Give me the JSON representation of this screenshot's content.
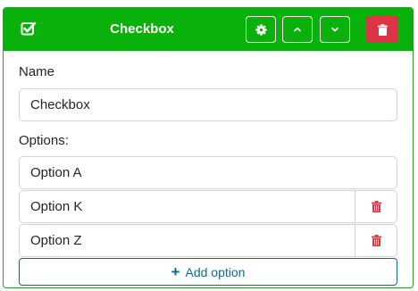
{
  "header": {
    "title": "Checkbox",
    "icon": "checkbox-icon",
    "color": "#0ab10a",
    "buttons": [
      {
        "name": "settings",
        "icon": "gear-icon"
      },
      {
        "name": "move-up",
        "icon": "chevron-up-icon"
      },
      {
        "name": "move-down",
        "icon": "chevron-down-icon"
      },
      {
        "name": "delete",
        "icon": "trash-icon",
        "color": "#dc3545"
      }
    ]
  },
  "form": {
    "name_label": "Name",
    "name_value": "Checkbox",
    "options_label": "Options:",
    "options": [
      {
        "value": "Option A",
        "deletable": false
      },
      {
        "value": "Option K",
        "deletable": true
      },
      {
        "value": "Option Z",
        "deletable": true
      }
    ],
    "add_option_label": "Add option",
    "accent_color": "#0d6a8f",
    "delete_color": "#dc3545"
  }
}
